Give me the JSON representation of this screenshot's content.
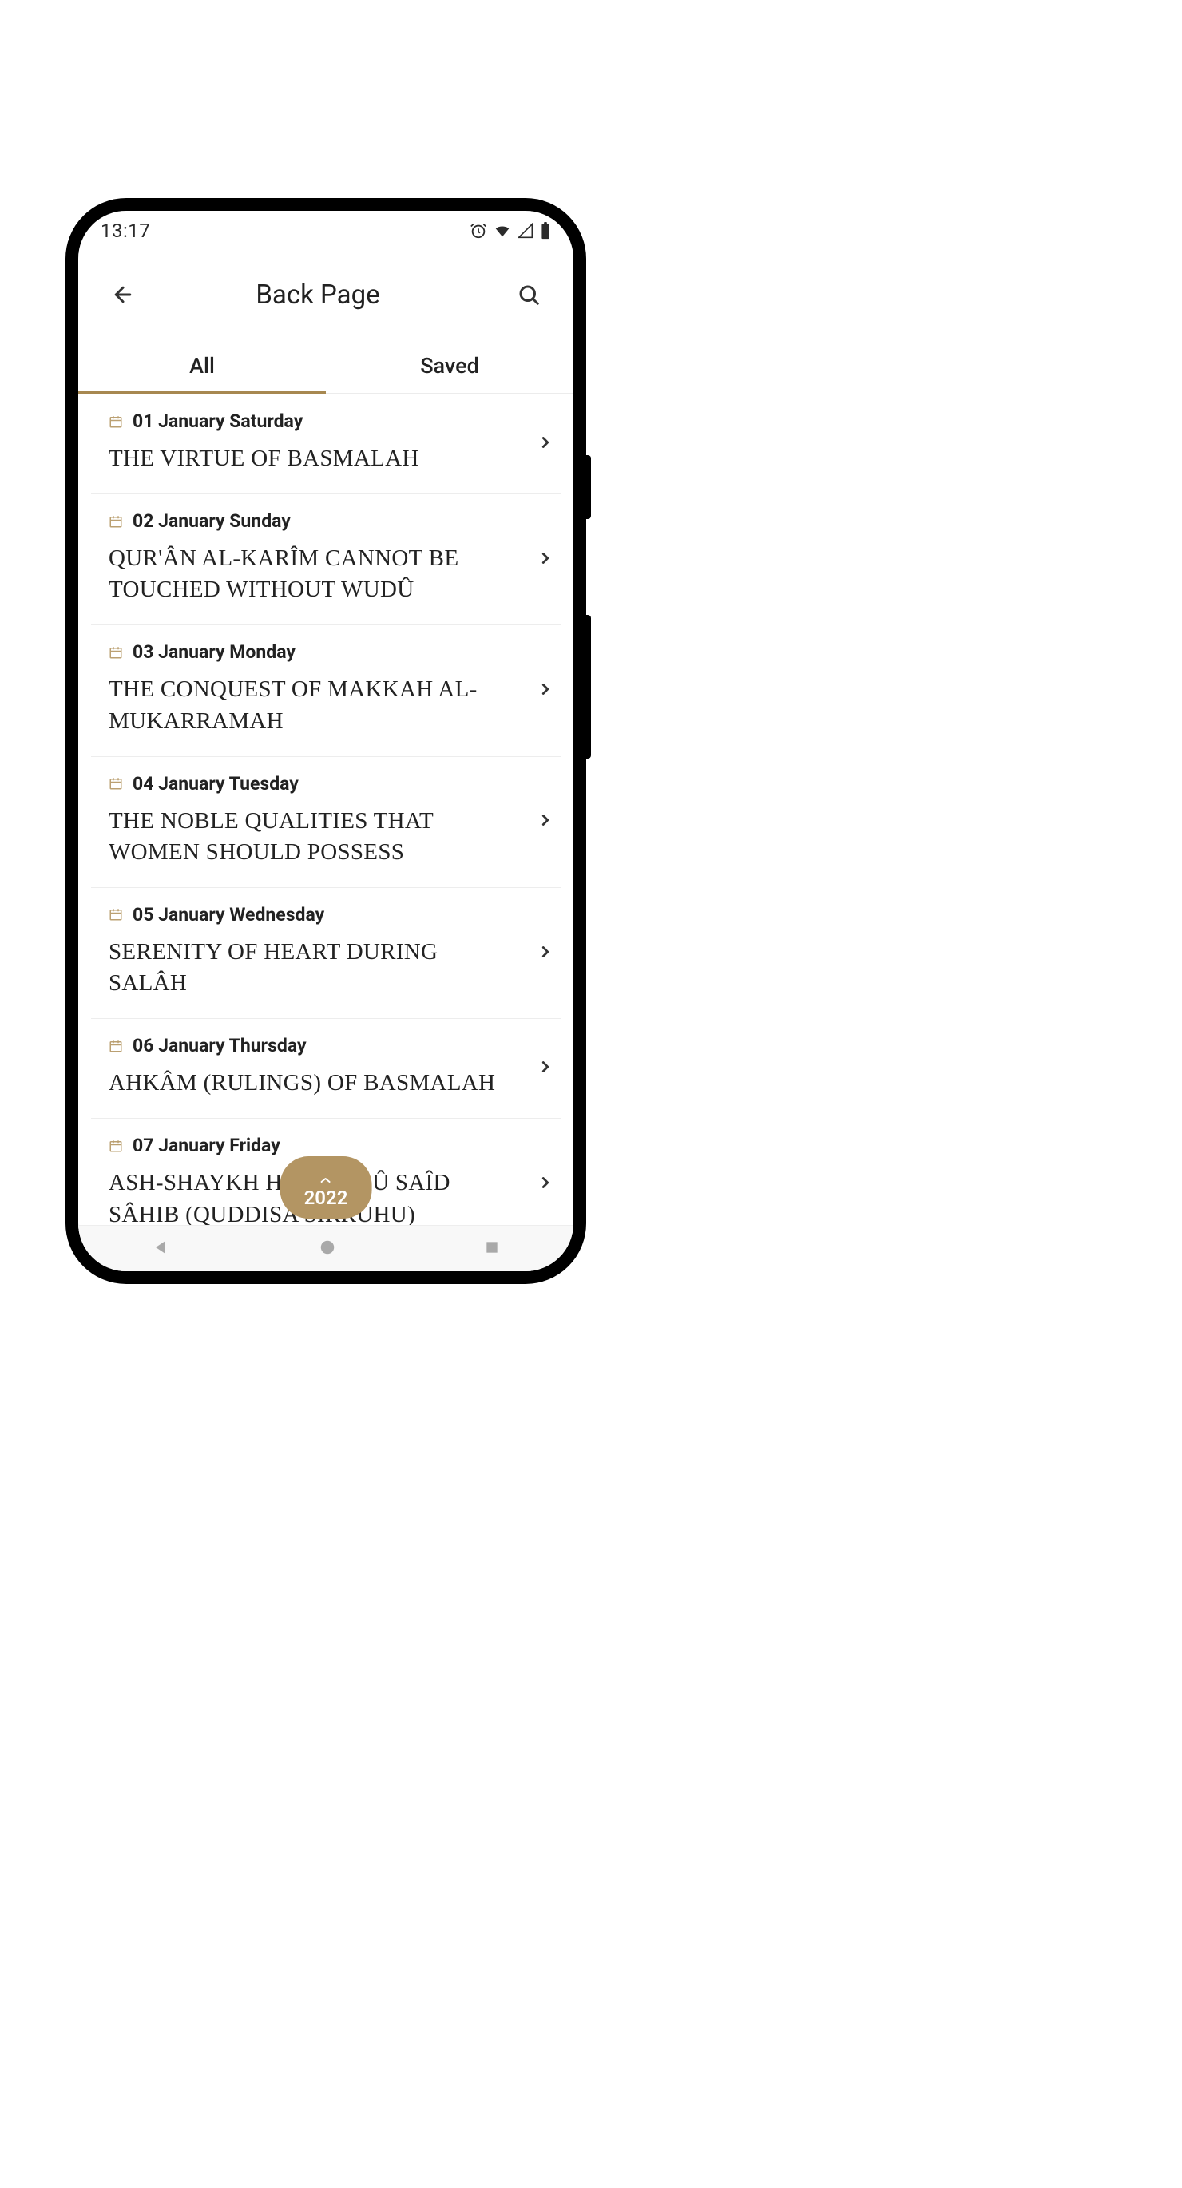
{
  "status": {
    "time": "13:17"
  },
  "header": {
    "title": "Back Page"
  },
  "tabs": {
    "all": "All",
    "saved": "Saved",
    "active": "all"
  },
  "year_pill": "2022",
  "list": {
    "items": [
      {
        "date": "01 January Saturday",
        "title": "THE VIRTUE OF BASMALAH"
      },
      {
        "date": "02 January Sunday",
        "title": "QUR'ÂN AL-KARÎM CANNOT BE TOUCHED WITHOUT WUDÛ"
      },
      {
        "date": "03 January Monday",
        "title": "THE CONQUEST OF MAKKAH AL-MUKARRAMAH"
      },
      {
        "date": "04 January Tuesday",
        "title": "THE NOBLE QUALITIES THAT WOMEN SHOULD POSSESS"
      },
      {
        "date": "05 January Wednesday",
        "title": "SERENITY OF HEART DURING SALÂH"
      },
      {
        "date": "06 January Thursday",
        "title": "AHKÂM (RULINGS) OF BASMALAH"
      },
      {
        "date": "07 January Friday",
        "title": "ASH-SHAYKH HÂFIZ ABÛ SAÎD SÂHIB (QUDDISA SIRRUHU)"
      }
    ]
  }
}
